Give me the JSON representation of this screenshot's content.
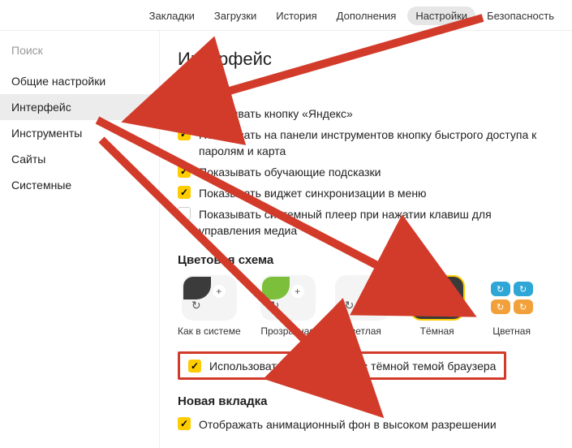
{
  "topTabs": {
    "items": [
      "Закладки",
      "Загрузки",
      "История",
      "Дополнения",
      "Настройки",
      "Безопасность"
    ],
    "activeIndex": 4
  },
  "sidebar": {
    "searchPlaceholder": "Поиск",
    "items": [
      "Общие настройки",
      "Интерфейс",
      "Инструменты",
      "Сайты",
      "Системные"
    ],
    "activeIndex": 1
  },
  "page": {
    "title": "Интерфейс"
  },
  "general": {
    "checks": [
      {
        "label": "Показывать кнопку «Яндекс»",
        "checked": true
      },
      {
        "label": "Показывать на панели инструментов кнопку быстрого доступа к паролям и карта",
        "checked": true
      },
      {
        "label": "Показывать обучающие подсказки",
        "checked": true
      },
      {
        "label": "Показывать виджет синхронизации в меню",
        "checked": true
      },
      {
        "label": "Показывать системный плеер при нажатии клавиш для управления медиа",
        "checked": false
      }
    ]
  },
  "colorScheme": {
    "heading": "Цветовая схема",
    "options": [
      {
        "key": "system",
        "label": "Как в системе"
      },
      {
        "key": "transparent",
        "label": "Прозрачная"
      },
      {
        "key": "light",
        "label": "Светлая"
      },
      {
        "key": "dark",
        "label": "Тёмная"
      },
      {
        "key": "color",
        "label": "Цветная"
      }
    ],
    "selectedKey": "dark",
    "darkBackgroundsLabel": "Использовать тёмные фоны с тёмной темой браузера",
    "darkBackgroundsChecked": true
  },
  "newTab": {
    "heading": "Новая вкладка",
    "checks": [
      {
        "label": "Отображать анимационный фон в высоком разрешении",
        "checked": true
      }
    ]
  },
  "annotationColor": "#d23b2a"
}
